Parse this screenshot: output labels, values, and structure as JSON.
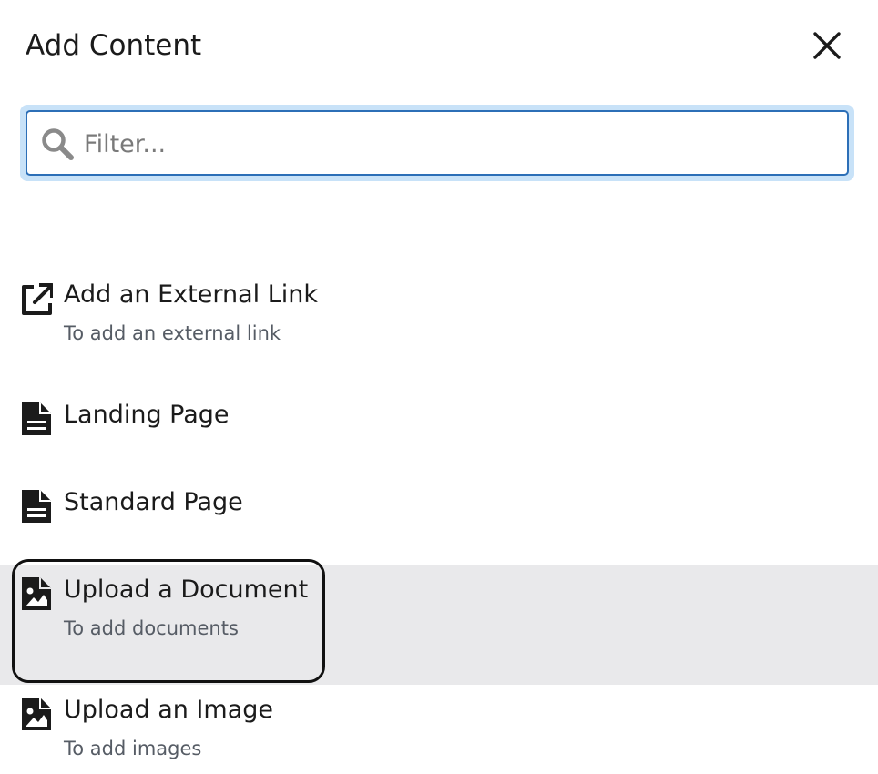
{
  "dialog": {
    "title": "Add Content",
    "close_icon": "close-icon"
  },
  "filter": {
    "placeholder": "Filter...",
    "value": "",
    "icon": "search-icon"
  },
  "items": [
    {
      "title": "Add an External Link",
      "description": "To add an external link",
      "icon": "external-link-icon"
    },
    {
      "title": "Landing Page",
      "description": "",
      "icon": "document-icon"
    },
    {
      "title": "Standard Page",
      "description": "",
      "icon": "document-icon"
    },
    {
      "title": "Upload a Document",
      "description": "To add documents",
      "icon": "image-file-icon",
      "highlighted": true,
      "focused": true
    },
    {
      "title": "Upload an Image",
      "description": "To add images",
      "icon": "image-file-icon"
    }
  ],
  "colors": {
    "focus_blue": "#2c6fb7",
    "focus_glow": "#c8e2f8",
    "highlight_bg": "#e9e9eb",
    "text": "#1b1b1b",
    "muted_text": "#565c65"
  }
}
